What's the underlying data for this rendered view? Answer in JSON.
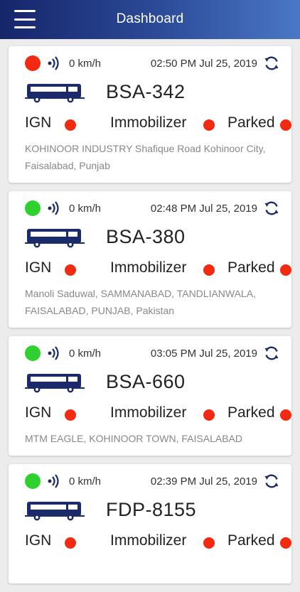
{
  "header": {
    "title": "Dashboard"
  },
  "colors": {
    "online": "#2ed12e",
    "offline": "#f32a12",
    "accent": "#1b2a6b"
  },
  "labels": {
    "ign": "IGN",
    "immobilizer": "Immobilizer",
    "parked": "Parked"
  },
  "vehicles": [
    {
      "status_color": "#f32a12",
      "speed": "0 km/h",
      "timestamp": "02:50 PM Jul 25, 2019",
      "plate": "BSA-342",
      "address": "KOHINOOR INDUSTRY Shafique Road Kohinoor City, Faisalabad, Punjab"
    },
    {
      "status_color": "#2ed12e",
      "speed": "0 km/h",
      "timestamp": "02:48 PM Jul 25, 2019",
      "plate": "BSA-380",
      "address": "Manoli Saduwal, SAMMANABAD, TANDLIANWALA, FAISALABAD, PUNJAB, Pakistan"
    },
    {
      "status_color": "#2ed12e",
      "speed": "0 km/h",
      "timestamp": "03:05 PM Jul 25, 2019",
      "plate": "BSA-660",
      "address": "MTM EAGLE, KOHINOOR TOWN, FAISALABAD"
    },
    {
      "status_color": "#2ed12e",
      "speed": "0 km/h",
      "timestamp": "02:39 PM Jul 25, 2019",
      "plate": "FDP-8155",
      "address": ""
    }
  ]
}
